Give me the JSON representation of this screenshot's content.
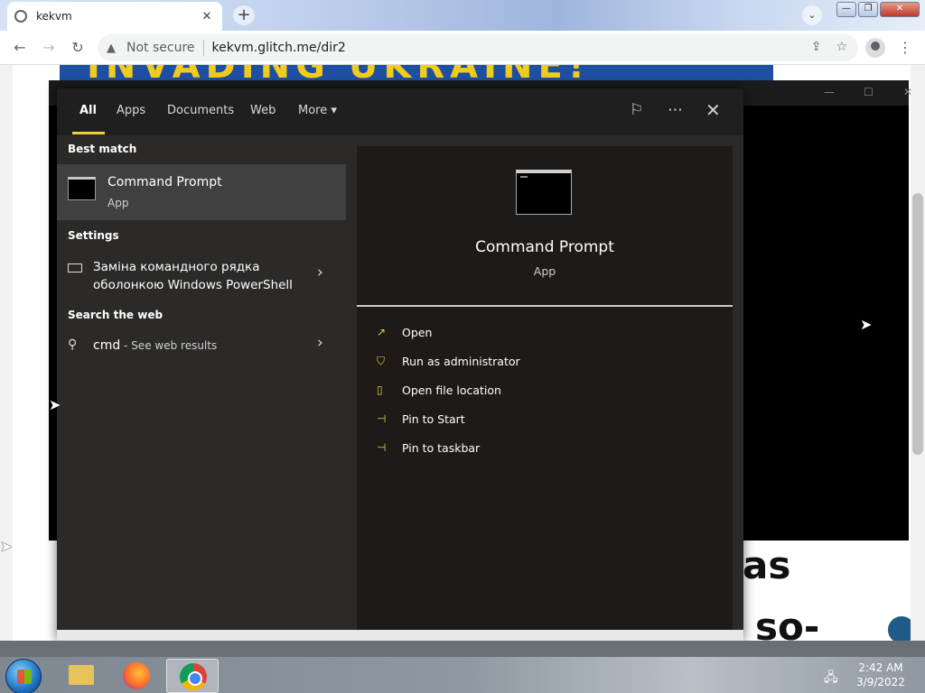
{
  "browser": {
    "tab_title": "kekvm",
    "tab_close": "✕",
    "new_tab": "+",
    "tab_search": "⌄",
    "security_label": "Not secure",
    "url": "kekvm.glitch.me/dir2"
  },
  "page": {
    "banner_text": "INVADING UKRAINE!",
    "word_1": "as",
    "word_2": "so-"
  },
  "search": {
    "tabs": [
      "All",
      "Apps",
      "Documents",
      "Web",
      "More"
    ],
    "more_arrow": "▾",
    "best_match_label": "Best match",
    "best_match": {
      "name": "Command Prompt",
      "type": "App"
    },
    "settings_label": "Settings",
    "settings_item": "Заміна командного рядка оболонкою Windows PowerShell",
    "web_label": "Search the web",
    "web_query": "cmd",
    "web_suffix": " - See web results",
    "details": {
      "name": "Command Prompt",
      "type": "App",
      "actions": [
        "Open",
        "Run as administrator",
        "Open file location",
        "Pin to Start",
        "Pin to taskbar"
      ]
    }
  },
  "taskbar": {
    "time": "2:42 AM",
    "date": "3/9/2022"
  },
  "colors": {
    "accent": "#f1d13a",
    "flyout_bg": "#2b2a29",
    "detail_bg": "#1e1a18"
  }
}
